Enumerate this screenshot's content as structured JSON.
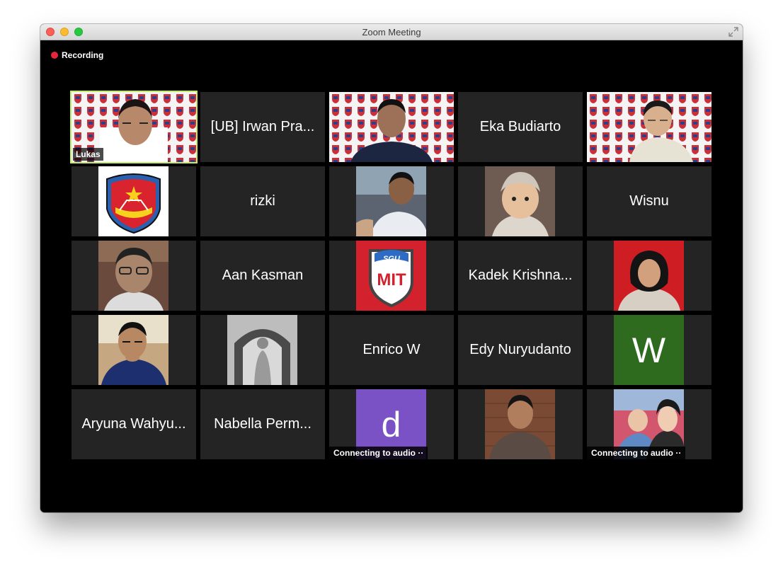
{
  "window": {
    "title": "Zoom Meeting"
  },
  "recording": {
    "label": "Recording"
  },
  "participants": {
    "lukas": {
      "name": "Lukas"
    },
    "irwan": {
      "name": "[UB] Irwan Pra..."
    },
    "eka": {
      "name": "Eka Budiarto"
    },
    "rizki": {
      "name": "rizki"
    },
    "wisnu": {
      "name": "Wisnu"
    },
    "aan": {
      "name": "Aan Kasman"
    },
    "kadek": {
      "name": "Kadek Krishna..."
    },
    "enrico": {
      "name": "Enrico W"
    },
    "edy": {
      "name": "Edy Nuryudanto"
    },
    "w_tile": {
      "initial": "W"
    },
    "aryuna": {
      "name": "Aryuna Wahyu..."
    },
    "nabella": {
      "name": "Nabella Perm..."
    },
    "d_tile": {
      "initial": "d",
      "status": "Connecting to audio ··"
    },
    "family": {
      "status": "Connecting to audio ··"
    }
  },
  "logos": {
    "mit": {
      "top": "SGU",
      "main": "MIT"
    }
  },
  "colors": {
    "accent_border": "#c4eb6c",
    "avatar_green": "#2f6b1e",
    "avatar_purple": "#7b52c6",
    "recording_dot": "#e8263a",
    "mit_red": "#d3222e"
  }
}
